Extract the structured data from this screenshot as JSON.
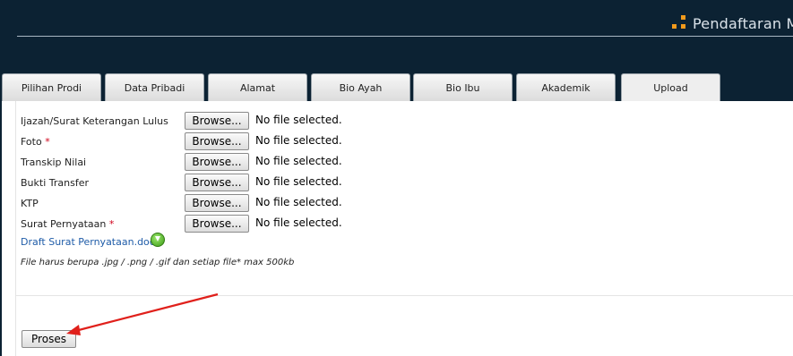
{
  "header": {
    "site_title": "Pendaftaran M",
    "accent_color": "#f29a1c",
    "background_color": "#0c2233"
  },
  "tabs": [
    {
      "label": "Pilihan Prodi",
      "active": false
    },
    {
      "label": "Data Pribadi",
      "active": false
    },
    {
      "label": "Alamat",
      "active": false
    },
    {
      "label": "Bio Ayah",
      "active": false
    },
    {
      "label": "Bio Ibu",
      "active": false
    },
    {
      "label": "Akademik",
      "active": false
    },
    {
      "label": "Upload",
      "active": true
    }
  ],
  "upload": {
    "fields": [
      {
        "label": "Ijazah/Surat Keterangan Lulus",
        "required": false,
        "button": "Browse...",
        "status": "No file selected."
      },
      {
        "label": "Foto",
        "required": true,
        "button": "Browse...",
        "status": "No file selected."
      },
      {
        "label": "Transkip Nilai",
        "required": false,
        "button": "Browse...",
        "status": "No file selected."
      },
      {
        "label": "Bukti Transfer",
        "required": false,
        "button": "Browse...",
        "status": "No file selected."
      },
      {
        "label": "KTP",
        "required": false,
        "button": "Browse...",
        "status": "No file selected."
      },
      {
        "label": "Surat Pernyataan",
        "required": true,
        "button": "Browse...",
        "status": "No file selected."
      }
    ],
    "required_marker": "*",
    "draft_link": "Draft Surat Pernyataan.docx",
    "note": "File harus berupa .jpg / .png / .gif dan setiap file* max 500kb",
    "submit_label": "Proses"
  },
  "colors": {
    "required": "#d0021b",
    "link": "#1f5ca8",
    "arrow": "#e0201b"
  }
}
